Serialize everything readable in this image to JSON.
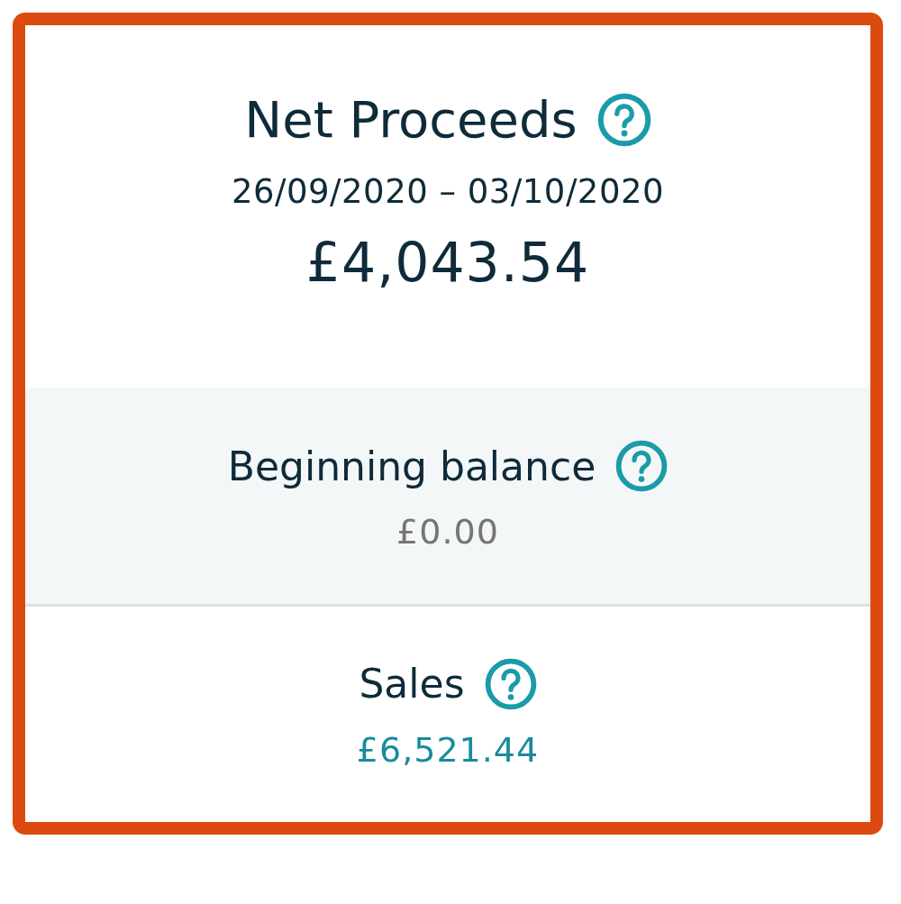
{
  "summary": {
    "title": "Net Proceeds",
    "period": "26/09/2020 – 03/10/2020",
    "amount": "£4,043.54"
  },
  "sections": [
    {
      "label": "Beginning balance",
      "value": "£0.00",
      "link": false
    },
    {
      "label": "Sales",
      "value": "£6,521.44",
      "link": true
    }
  ]
}
